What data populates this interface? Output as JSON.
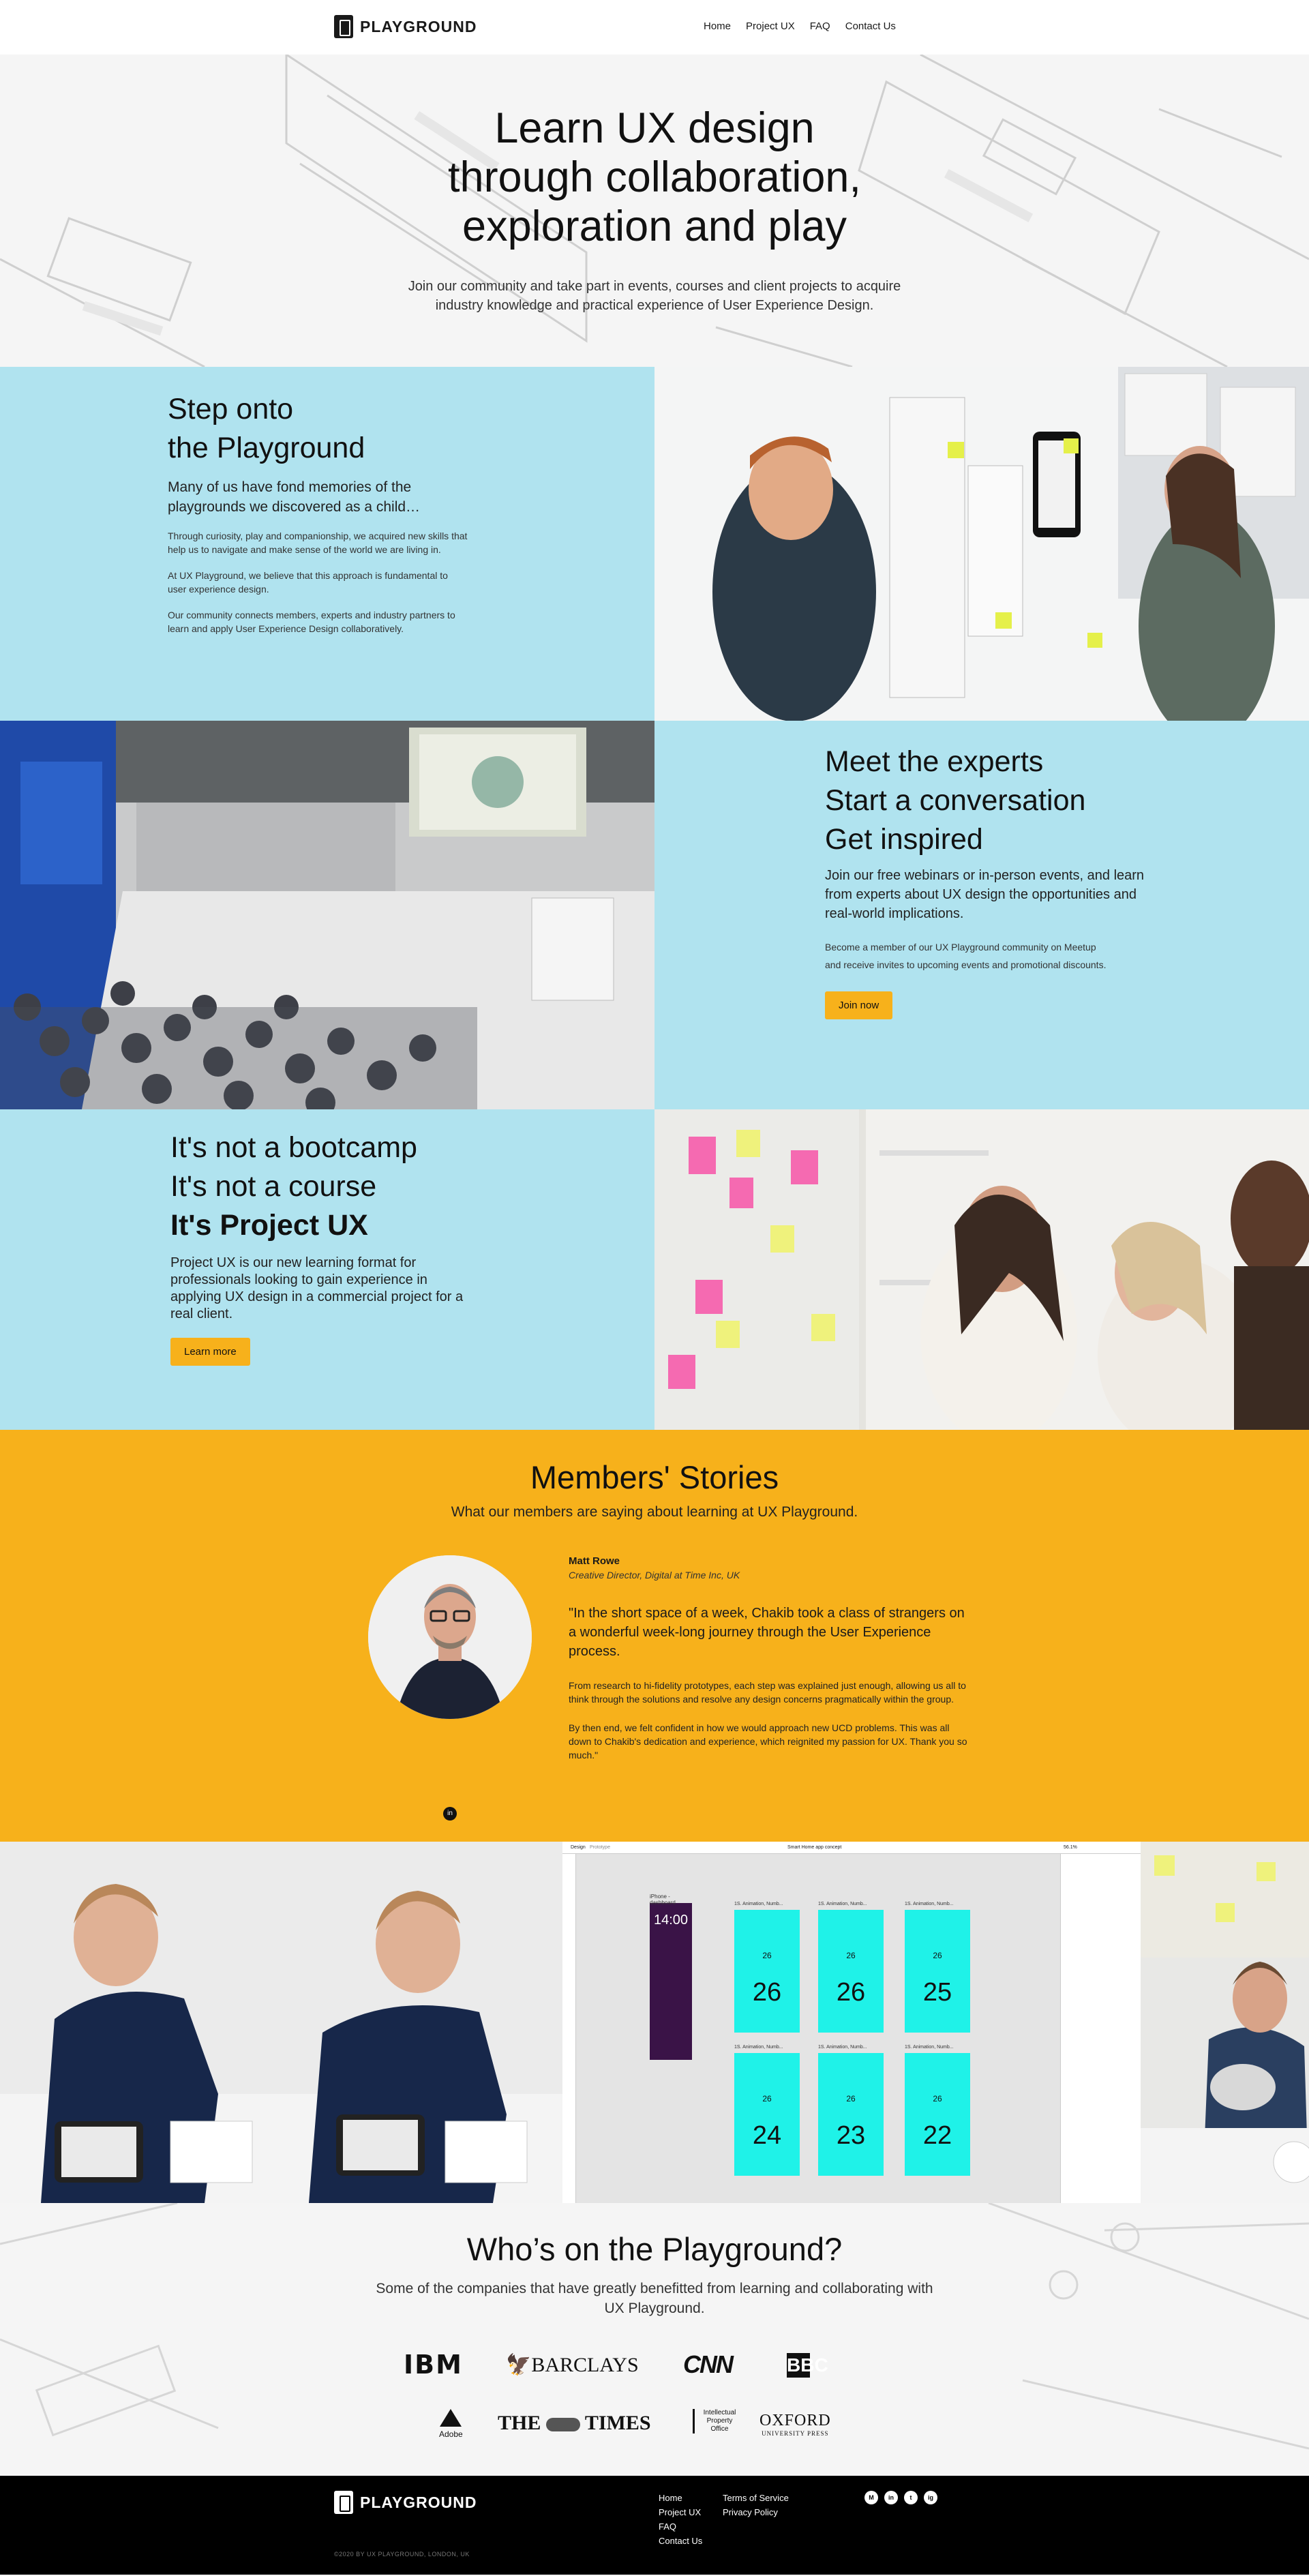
{
  "header": {
    "logo": "PLAYGROUND",
    "nav": [
      "Home",
      "Project UX",
      "FAQ",
      "Contact Us"
    ]
  },
  "hero": {
    "title_lines": [
      "Learn UX design",
      "through collaboration,",
      "exploration and play"
    ],
    "subtitle": "Join our community and take part in events, courses and client projects to acquire industry knowledge and practical experience of User Experience Design."
  },
  "playground": {
    "title_lines": [
      "Step onto",
      "the Playground"
    ],
    "lead": "Many of us have fond memories of the playgrounds we discovered as a child…",
    "paragraphs": [
      "Through curiosity, play and companionship, we acquired new skills that help us to navigate and make sense of the world we are living in.",
      "At UX Playground, we believe that this approach is fundamental to user experience design.",
      "Our community connects members, experts and industry partners to learn and apply User Experience Design collaboratively."
    ]
  },
  "experts": {
    "title_lines": [
      "Meet the experts",
      "Start a conversation",
      "Get inspired"
    ],
    "lead": "Join our free webinars or in-person events, and learn from experts about UX design the opportunities and real-world implications.",
    "small": "Become a member of our UX Playground community on Meetup and receive invites to upcoming events and promotional discounts.",
    "button": "Join now"
  },
  "projectux": {
    "line1": "It's not a bootcamp",
    "line2": "It's not a course",
    "line3": "It's Project UX",
    "lead": "Project UX is our new learning format for professionals looking to gain experience in applying UX design in a commercial project for a real client.",
    "button": "Learn more"
  },
  "stories": {
    "title": "Members' Stories",
    "subtitle": "What our members are saying about learning at UX Playground.",
    "name": "Matt Rowe",
    "role": "Creative Director, Digital at Time Inc, UK",
    "quote": "\"In the short space of a week, Chakib took a class of strangers on a wonderful week-long journey through the User Experience process.",
    "p1": "From research to hi-fidelity prototypes, each step was explained just enough, allowing us all to think through the solutions and resolve any design concerns pragmatically within the group.",
    "p2": "By then end, we felt confident in how we would approach new UCD problems. This was all down to Chakib's dedication and experience, which reignited my passion for UX. Thank you so much.\"",
    "linkedin": "in",
    "dots": 5,
    "active_dot": 1
  },
  "mockup": {
    "tabs": [
      "Design",
      "Prototype"
    ],
    "doc_title": "Smart Home app concept",
    "zoom": "56.1%",
    "card_title": "iPhone - dashboard",
    "card_time": "14:00",
    "screen_label": "1S. Animation, Numb...",
    "temps": [
      "26",
      "26",
      "25",
      "24",
      "23",
      "22"
    ],
    "small_temp": "26"
  },
  "companies": {
    "title": "Who’s on the Playground?",
    "subtitle": "Some of the companies that have greatly benefitted from learning and collaborating with UX Playground.",
    "row1": [
      "IBM",
      "BARCLAYS",
      "CNN",
      "BBC"
    ],
    "row2": [
      "Adobe",
      "THE",
      "TIMES",
      "Intellectual Property Office",
      "OXFORD",
      "UNIVERSITY PRESS"
    ]
  },
  "footer": {
    "logo": "PLAYGROUND",
    "col1": [
      "Home",
      "Project UX",
      "FAQ",
      "Contact Us"
    ],
    "col2": [
      "Terms of Service",
      "Privacy Policy"
    ],
    "social": [
      "M",
      "in",
      "t",
      "ig"
    ],
    "copyright": "©2020 BY UX PLAYGROUND, LONDON, UK"
  },
  "colors": {
    "accent": "#f7b11b",
    "panel_blue": "#b0e3ef",
    "screen_cyan": "#1ff2e8",
    "footer_bg": "#000000"
  }
}
